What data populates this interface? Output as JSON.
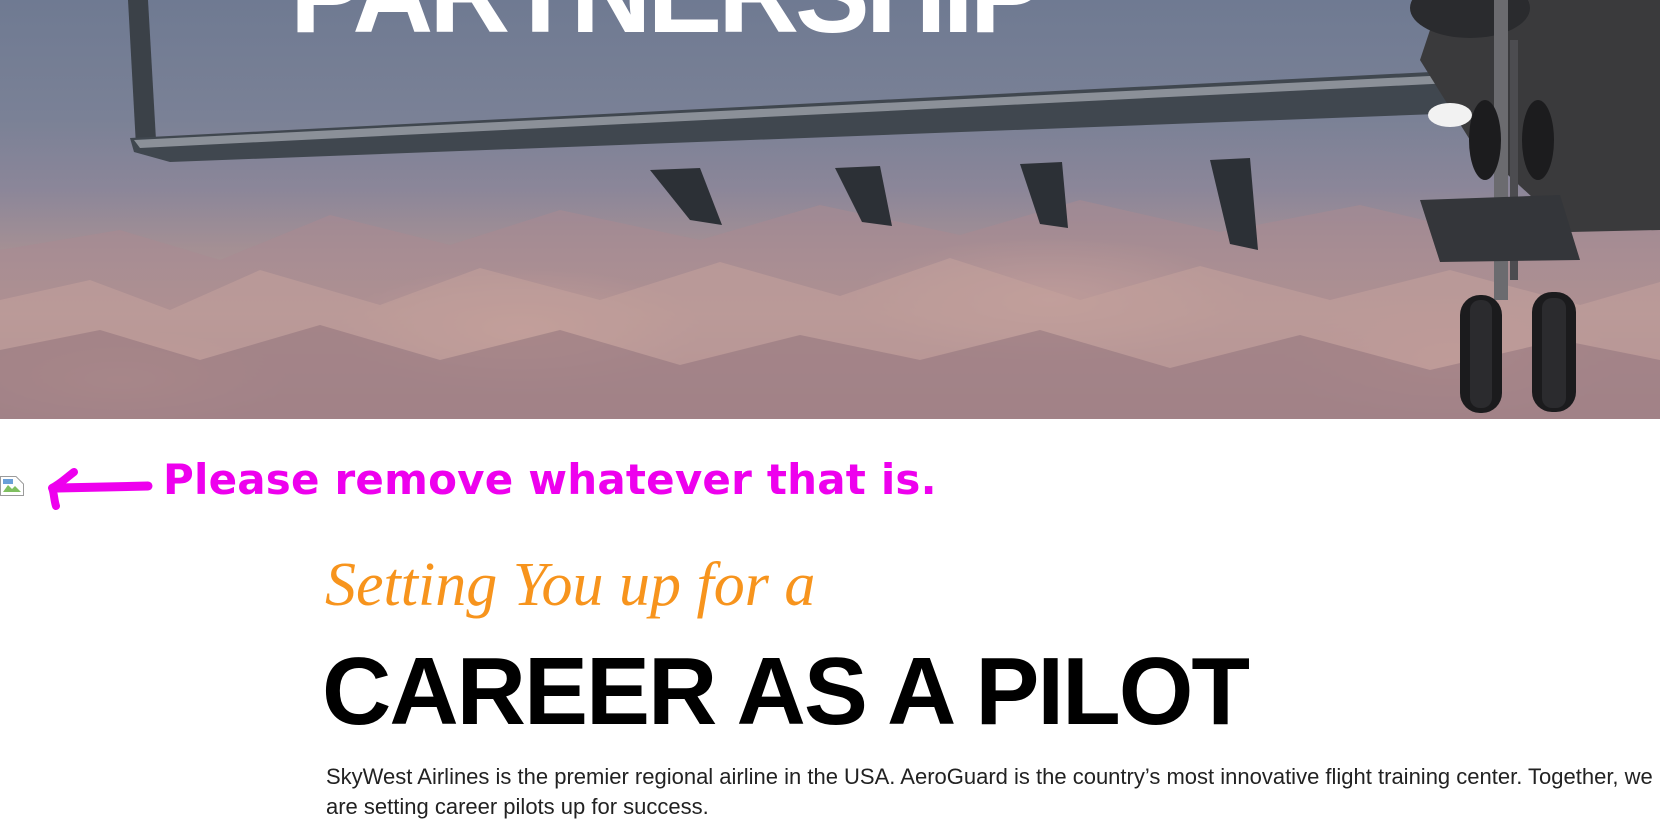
{
  "hero": {
    "headline": "PARTNERSHIP",
    "image_alt": "regional jet flying over desert mountains"
  },
  "annotation": {
    "text": "Please remove whatever that is.",
    "color": "#ee00ee"
  },
  "content": {
    "subhead": "Setting You up for a",
    "heading": "CAREER AS A PILOT",
    "body": "SkyWest Airlines is the premier regional airline in the USA. AeroGuard is the country’s most innovative flight training center. Together, we are setting career pilots up for success."
  },
  "colors": {
    "accent_orange": "#f7941d",
    "annotation_magenta": "#ee00ee"
  },
  "icons": {
    "broken_image": "broken-image-icon",
    "annotation_arrow": "arrow-left-icon"
  }
}
